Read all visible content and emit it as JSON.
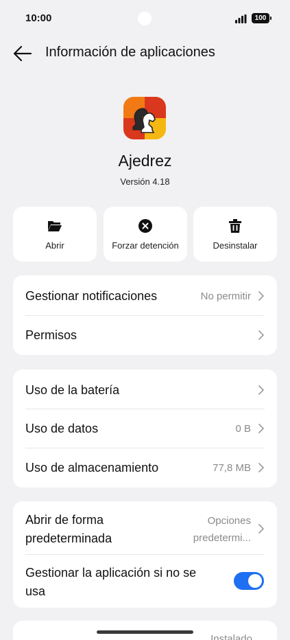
{
  "status": {
    "time": "10:00",
    "battery": "100"
  },
  "header": {
    "title": "Información de aplicaciones"
  },
  "app": {
    "name": "Ajedrez",
    "version": "Versión 4.18"
  },
  "actions": [
    {
      "label": "Abrir",
      "icon": "folder-open-icon"
    },
    {
      "label": "Forzar detención",
      "icon": "close-circle-icon"
    },
    {
      "label": "Desinstalar",
      "icon": "trash-icon"
    }
  ],
  "group1": [
    {
      "label": "Gestionar notificaciones",
      "value": "No permitir"
    },
    {
      "label": "Permisos",
      "value": ""
    }
  ],
  "group2": [
    {
      "label": "Uso de la batería",
      "value": ""
    },
    {
      "label": "Uso de datos",
      "value": "0 B"
    },
    {
      "label": "Uso de almacenamiento",
      "value": "77,8 MB"
    }
  ],
  "group3": {
    "default_open": {
      "label_line1": "Abrir de forma",
      "label_line2": "predeterminada",
      "value_line1": "Opciones",
      "value_line2": "predetermi..."
    },
    "manage_unused": {
      "label_line1": "Gestionar la aplicación si no se",
      "label_line2": "usa",
      "toggle_on": true
    }
  },
  "group4": {
    "value": "Instalado"
  },
  "colors": {
    "accent": "#1e6ff1",
    "background": "#f1f1f3",
    "card": "#ffffff"
  }
}
